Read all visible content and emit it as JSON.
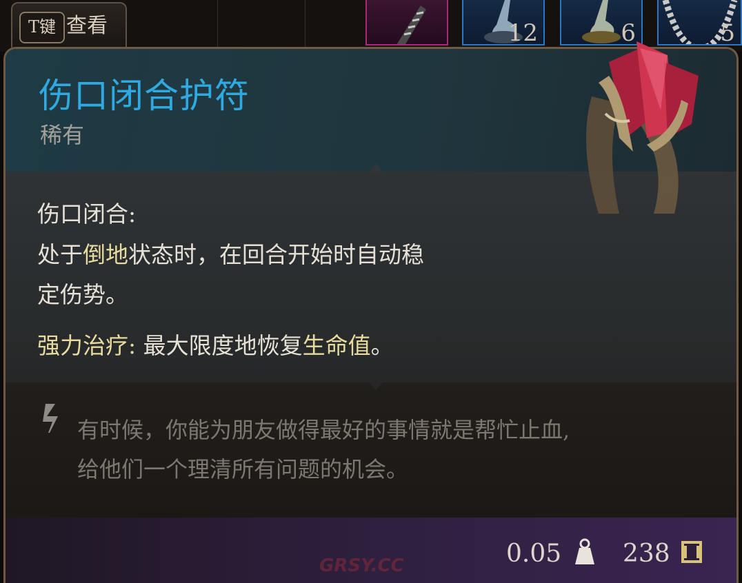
{
  "top_bar": {
    "inspect_key": "T键",
    "inspect_label": "查看",
    "slots": [
      {
        "icon": "serrated-blade-icon",
        "count": ""
      },
      {
        "icon": "potion-bottle-icon",
        "count": "12"
      },
      {
        "icon": "potion-bottle-icon",
        "count": "6"
      },
      {
        "icon": "chain-necklace-icon",
        "count": "5"
      }
    ]
  },
  "item": {
    "name": "伤口闭合护符",
    "rarity": "稀有",
    "name_color": "#2fa9df",
    "description": {
      "ability_name": "伤口闭合:",
      "line1_a": "处于",
      "line1_hl": "倒地",
      "line1_b": "状态时，在回合开始时自动稳",
      "line2": "定伤势。",
      "heal_name": "强力治疗:",
      "heal_a": " 最大限度地恢复",
      "heal_hl": "生命值",
      "heal_b": "。"
    },
    "lore": {
      "line1": "有时候，你能为朋友做得最好的事情就是帮忙止血,",
      "line2": "给他们一个理清所有问题的机会。"
    },
    "weight": "0.05",
    "price": "238"
  },
  "watermark": "GRSY.CC"
}
